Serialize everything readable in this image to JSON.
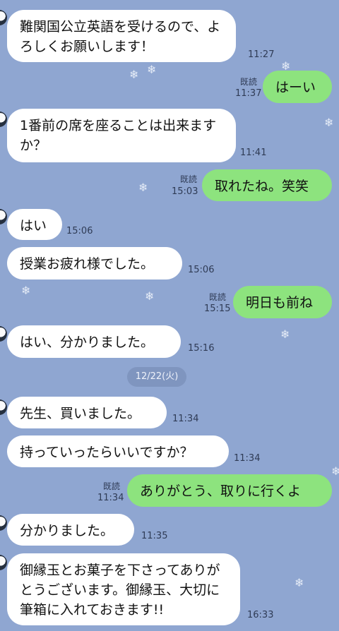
{
  "messages": [
    {
      "text": "難関国公立英語を受けるので、よろしくお願いします！",
      "time": "11:27"
    },
    {
      "text": "はーい",
      "read": "既読",
      "time": "11:37"
    },
    {
      "text": "1番前の席を座ることは出来ますか？",
      "time": "11:41"
    },
    {
      "text": "取れたね。笑笑",
      "read": "既読",
      "time": "15:03"
    },
    {
      "text": "はい",
      "time": "15:06"
    },
    {
      "text": "授業お疲れ様でした。",
      "time": "15:06"
    },
    {
      "text": "明日も前ね",
      "read": "既読",
      "time": "15:15"
    },
    {
      "text": "はい、分かりました。",
      "time": "15:16"
    },
    {
      "text": "先生、買いました。",
      "time": "11:34"
    },
    {
      "text": "持っていったらいいですか？",
      "time": "11:34"
    },
    {
      "text": "ありがとう、取りに行くよ",
      "read": "既読",
      "time": "11:34"
    },
    {
      "text": "分かりました。",
      "time": "11:35"
    },
    {
      "text": "御縁玉とお菓子を下さってありがとうございます。御縁玉、大切に筆箱に入れておきます!!",
      "time": "16:33"
    }
  ],
  "date_divider": "12/22(火)",
  "colors": {
    "background": "#8fa6d1",
    "incoming_bubble": "#ffffff",
    "outgoing_bubble": "#8de37e",
    "date_pill": "#7f95bf"
  }
}
